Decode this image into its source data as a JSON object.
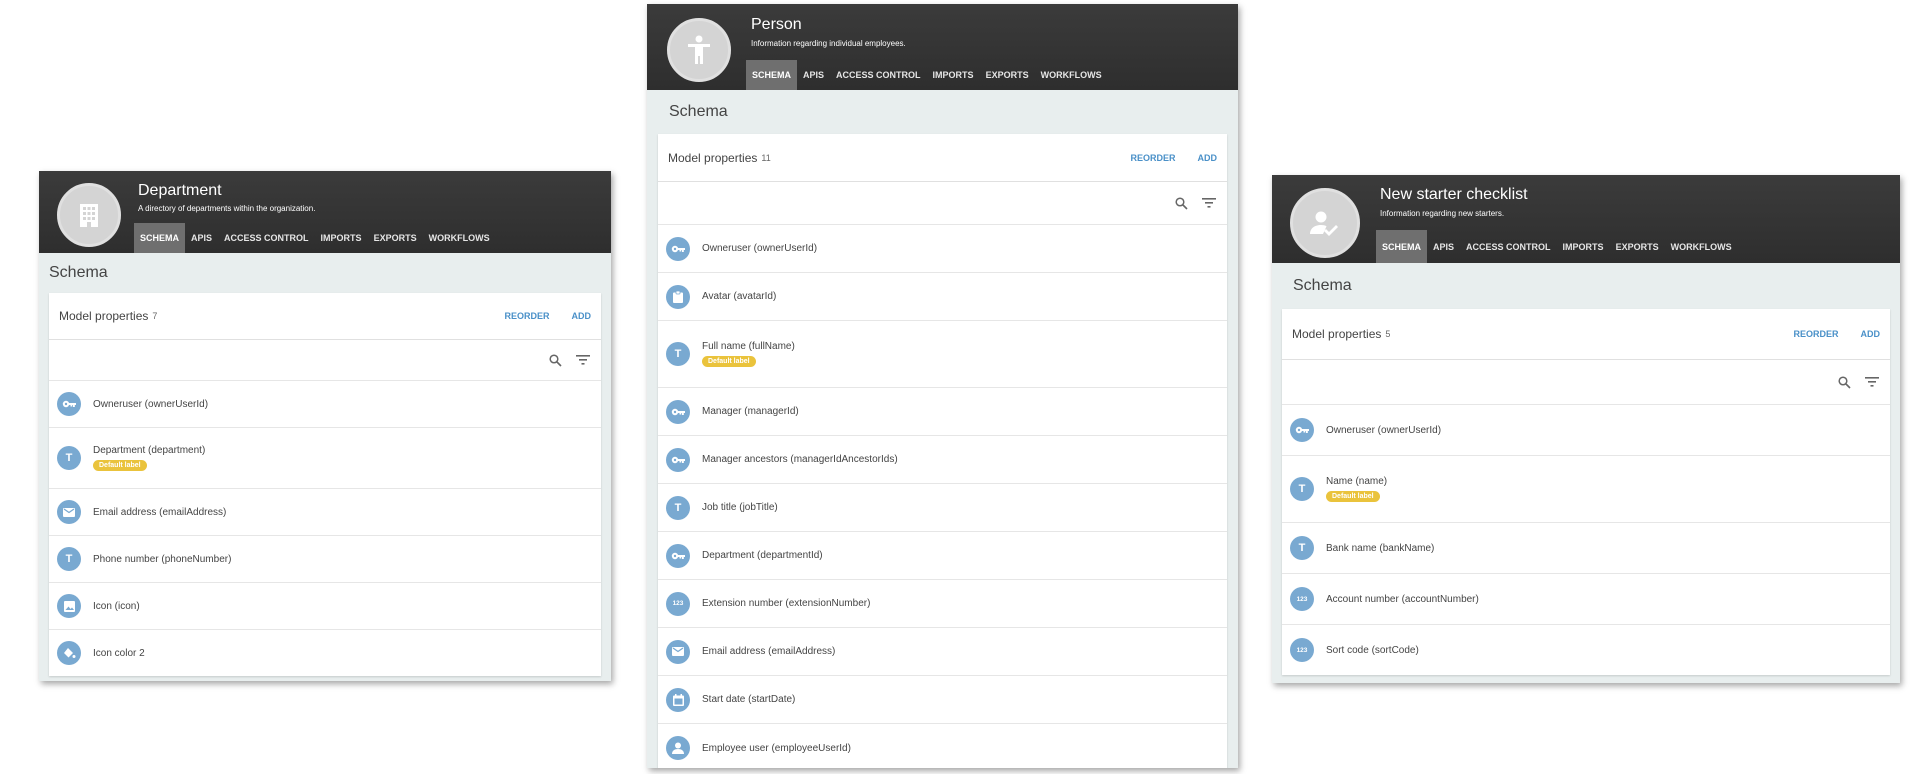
{
  "tabs": [
    "SCHEMA",
    "APIS",
    "ACCESS CONTROL",
    "IMPORTS",
    "EXPORTS",
    "WORKFLOWS"
  ],
  "schema_label": "Schema",
  "model_properties_label": "Model properties",
  "reorder_label": "REORDER",
  "add_label": "ADD",
  "default_label_badge": "Default label",
  "colors": {
    "header": "#2e2e2e",
    "accent": "#4a90c8",
    "icon_bg": "#79a9d1",
    "badge": "#eac33c"
  },
  "cards": {
    "department": {
      "title": "Department",
      "subtitle": "A directory of departments within the organization.",
      "avatar_icon": "building-icon",
      "count": "7",
      "rows": [
        {
          "label": "Owneruser (ownerUserId)",
          "icon": "key-icon"
        },
        {
          "label": "Department (department)",
          "icon": "text-icon",
          "badge": true
        },
        {
          "label": "Email address (emailAddress)",
          "icon": "email-icon"
        },
        {
          "label": "Phone number (phoneNumber)",
          "icon": "text-icon"
        },
        {
          "label": "Icon (icon)",
          "icon": "image-icon"
        },
        {
          "label": "Icon color 2",
          "icon": "paint-bucket-icon"
        }
      ]
    },
    "person": {
      "title": "Person",
      "subtitle": "Information regarding individual employees.",
      "avatar_icon": "person-icon",
      "count": "11",
      "rows": [
        {
          "label": "Owneruser (ownerUserId)",
          "icon": "key-icon"
        },
        {
          "label": "Avatar (avatarId)",
          "icon": "clipboard-icon"
        },
        {
          "label": "Full name (fullName)",
          "icon": "text-icon",
          "badge": true
        },
        {
          "label": "Manager (managerId)",
          "icon": "key-icon"
        },
        {
          "label": "Manager ancestors (managerIdAncestorIds)",
          "icon": "key-icon"
        },
        {
          "label": "Job title (jobTitle)",
          "icon": "text-icon"
        },
        {
          "label": "Department (departmentId)",
          "icon": "key-icon"
        },
        {
          "label": "Extension number (extensionNumber)",
          "icon": "number-icon"
        },
        {
          "label": "Email address (emailAddress)",
          "icon": "email-icon"
        },
        {
          "label": "Start date (startDate)",
          "icon": "calendar-icon"
        },
        {
          "label": "Employee user (employeeUserId)",
          "icon": "user-icon"
        }
      ]
    },
    "starter": {
      "title": "New starter checklist",
      "subtitle": "Information regarding new starters.",
      "avatar_icon": "user-check-icon",
      "count": "5",
      "rows": [
        {
          "label": "Owneruser (ownerUserId)",
          "icon": "key-icon"
        },
        {
          "label": "Name (name)",
          "icon": "text-icon",
          "badge": true
        },
        {
          "label": "Bank name (bankName)",
          "icon": "text-icon"
        },
        {
          "label": "Account number (accountNumber)",
          "icon": "number-icon"
        },
        {
          "label": "Sort code (sortCode)",
          "icon": "number-icon"
        }
      ]
    }
  }
}
